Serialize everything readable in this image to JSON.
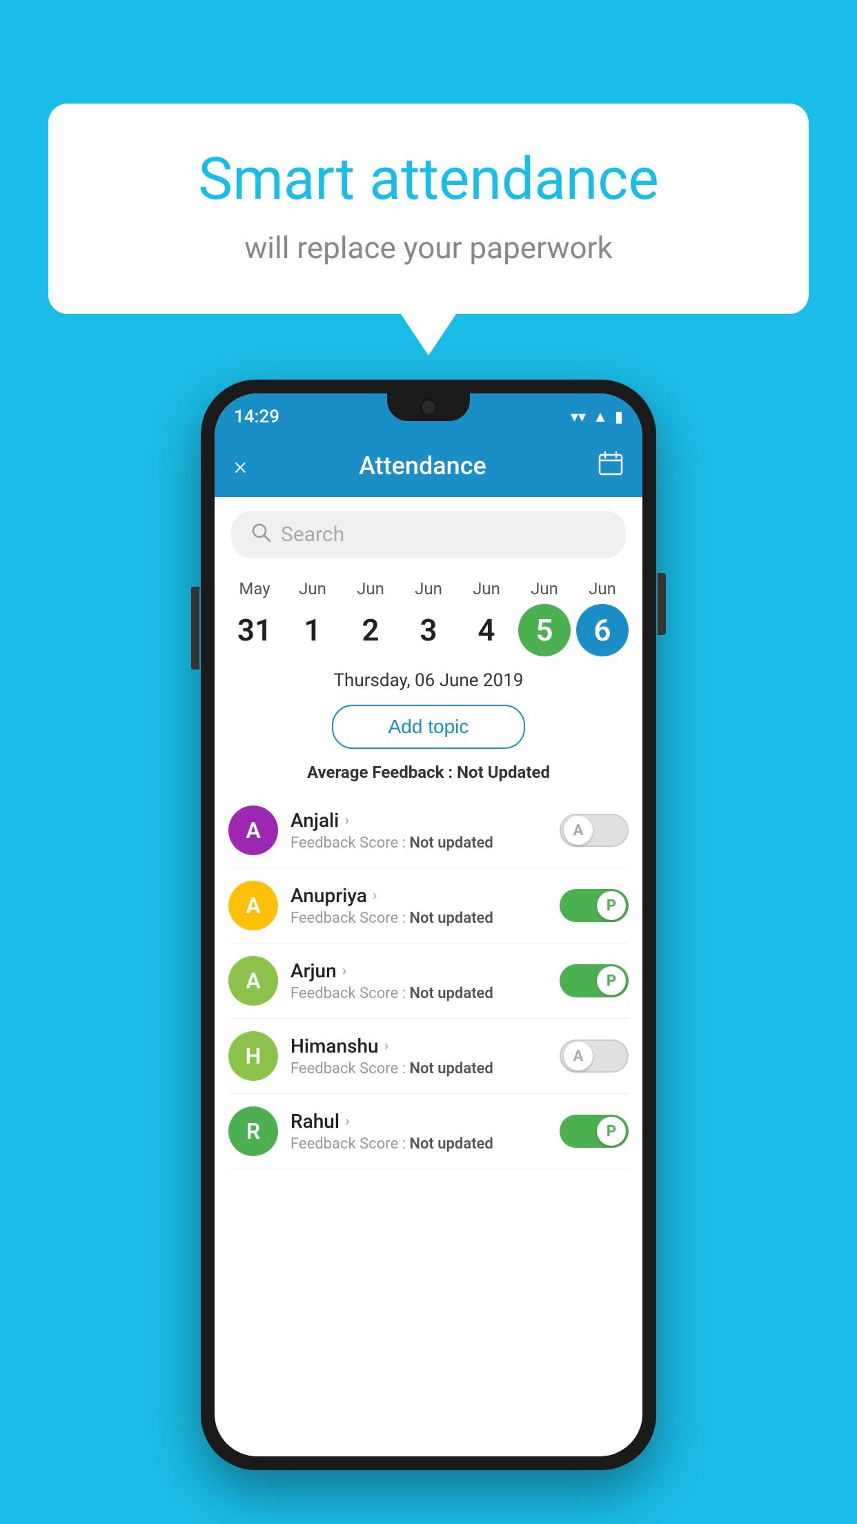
{
  "background_color": "#1ABDE8",
  "speech_bubble": {
    "title": "Smart attendance",
    "subtitle": "will replace your paperwork"
  },
  "status_bar": {
    "time": "14:29",
    "icons": [
      "wifi",
      "signal",
      "battery"
    ]
  },
  "app_bar": {
    "close_label": "×",
    "title": "Attendance",
    "calendar_icon": "📅"
  },
  "search": {
    "placeholder": "Search"
  },
  "calendar": {
    "days": [
      {
        "month": "May",
        "date": "31",
        "style": "normal"
      },
      {
        "month": "Jun",
        "date": "1",
        "style": "normal"
      },
      {
        "month": "Jun",
        "date": "2",
        "style": "normal"
      },
      {
        "month": "Jun",
        "date": "3",
        "style": "normal"
      },
      {
        "month": "Jun",
        "date": "4",
        "style": "normal"
      },
      {
        "month": "Jun",
        "date": "5",
        "style": "today"
      },
      {
        "month": "Jun",
        "date": "6",
        "style": "selected"
      }
    ]
  },
  "selected_date_label": "Thursday, 06 June 2019",
  "add_topic_label": "Add topic",
  "avg_feedback_prefix": "Average Feedback : ",
  "avg_feedback_value": "Not Updated",
  "students": [
    {
      "name": "Anjali",
      "avatar_letter": "A",
      "avatar_color": "#9C27B0",
      "score_prefix": "Feedback Score : ",
      "score_value": "Not updated",
      "toggle": "off",
      "toggle_label": "A"
    },
    {
      "name": "Anupriya",
      "avatar_letter": "A",
      "avatar_color": "#FFC107",
      "score_prefix": "Feedback Score : ",
      "score_value": "Not updated",
      "toggle": "on",
      "toggle_label": "P"
    },
    {
      "name": "Arjun",
      "avatar_letter": "A",
      "avatar_color": "#8BC34A",
      "score_prefix": "Feedback Score : ",
      "score_value": "Not updated",
      "toggle": "on",
      "toggle_label": "P"
    },
    {
      "name": "Himanshu",
      "avatar_letter": "H",
      "avatar_color": "#8BC34A",
      "score_prefix": "Feedback Score : ",
      "score_value": "Not updated",
      "toggle": "off",
      "toggle_label": "A"
    },
    {
      "name": "Rahul",
      "avatar_letter": "R",
      "avatar_color": "#4CAF50",
      "score_prefix": "Feedback Score : ",
      "score_value": "Not updated",
      "toggle": "on",
      "toggle_label": "P"
    }
  ]
}
